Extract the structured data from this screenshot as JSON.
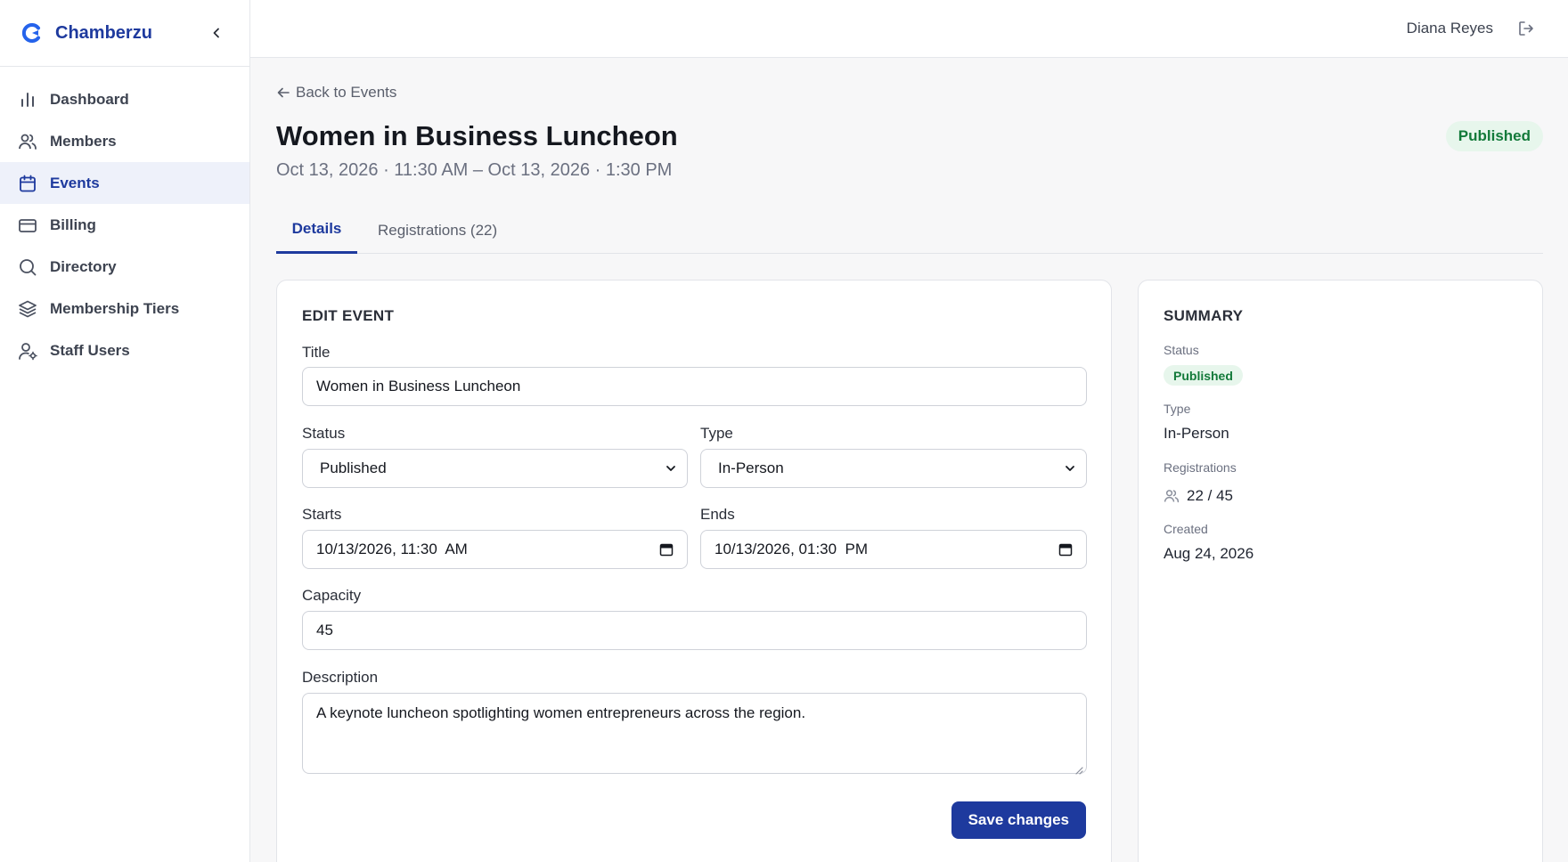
{
  "app": {
    "name": "Chamberzu",
    "brand_color": "#1e3a9e"
  },
  "sidebar": {
    "items": [
      {
        "label": "Dashboard",
        "icon": "bar-chart-icon"
      },
      {
        "label": "Members",
        "icon": "users-icon"
      },
      {
        "label": "Events",
        "icon": "calendar-icon",
        "active": true
      },
      {
        "label": "Billing",
        "icon": "credit-card-icon"
      },
      {
        "label": "Directory",
        "icon": "search-icon"
      },
      {
        "label": "Membership Tiers",
        "icon": "layers-icon"
      },
      {
        "label": "Staff Users",
        "icon": "user-cog-icon"
      }
    ]
  },
  "topbar": {
    "user_name": "Diana Reyes"
  },
  "page": {
    "back_label": "Back to Events",
    "title": "Women in Business Luncheon",
    "subtitle": "Oct 13, 2026 · 11:30 AM – Oct 13, 2026 · 1:30 PM",
    "status": "Published"
  },
  "tabs": [
    {
      "label": "Details",
      "active": true
    },
    {
      "label": "Registrations (22)",
      "active": false
    }
  ],
  "edit_form": {
    "heading": "EDIT EVENT",
    "title_label": "Title",
    "title_value": "Women in Business Luncheon",
    "status_label": "Status",
    "status_value": "Published",
    "type_label": "Type",
    "type_value": "In-Person",
    "starts_label": "Starts",
    "starts_value": "10/13/2026, 11:30  AM",
    "ends_label": "Ends",
    "ends_value": "10/13/2026, 01:30  PM",
    "capacity_label": "Capacity",
    "capacity_value": "45",
    "description_label": "Description",
    "description_value": "A keynote luncheon spotlighting women entrepreneurs across the region.",
    "save_label": "Save changes"
  },
  "summary": {
    "heading": "SUMMARY",
    "status_label": "Status",
    "status_value": "Published",
    "type_label": "Type",
    "type_value": "In-Person",
    "registrations_label": "Registrations",
    "registrations_value": "22 / 45",
    "created_label": "Created",
    "created_value": "Aug 24, 2026"
  },
  "colors": {
    "accent": "#1e3a9e",
    "success_bg": "#e7f6ec",
    "success_text": "#137a3a"
  }
}
